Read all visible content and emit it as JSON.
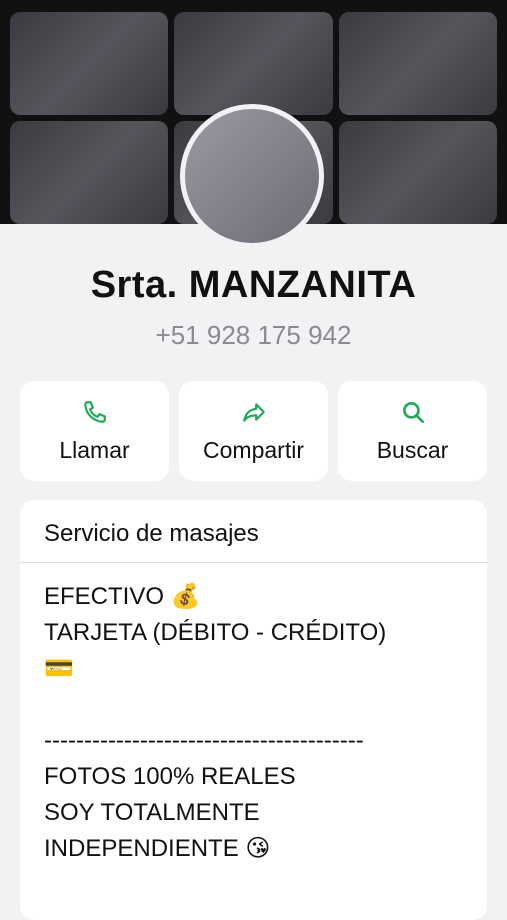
{
  "profile": {
    "name": "Srta. MANZANITA",
    "phone": "+51 928 175 942"
  },
  "actions": [
    {
      "label": "Llamar",
      "icon": "phone-icon"
    },
    {
      "label": "Compartir",
      "icon": "share-icon"
    },
    {
      "label": "Buscar",
      "icon": "search-icon"
    }
  ],
  "about": {
    "title": "Servicio de masajes",
    "body": "EFECTIVO 💰\nTARJETA (DÉBITO - CRÉDITO)\n💳\n\n----------------------------------------\nFOTOS 100% REALES\nSOY TOTALMENTE\nINDEPENDIENTE 😘"
  },
  "colors": {
    "accent": "#1fa855",
    "background": "#f2f2f4"
  }
}
